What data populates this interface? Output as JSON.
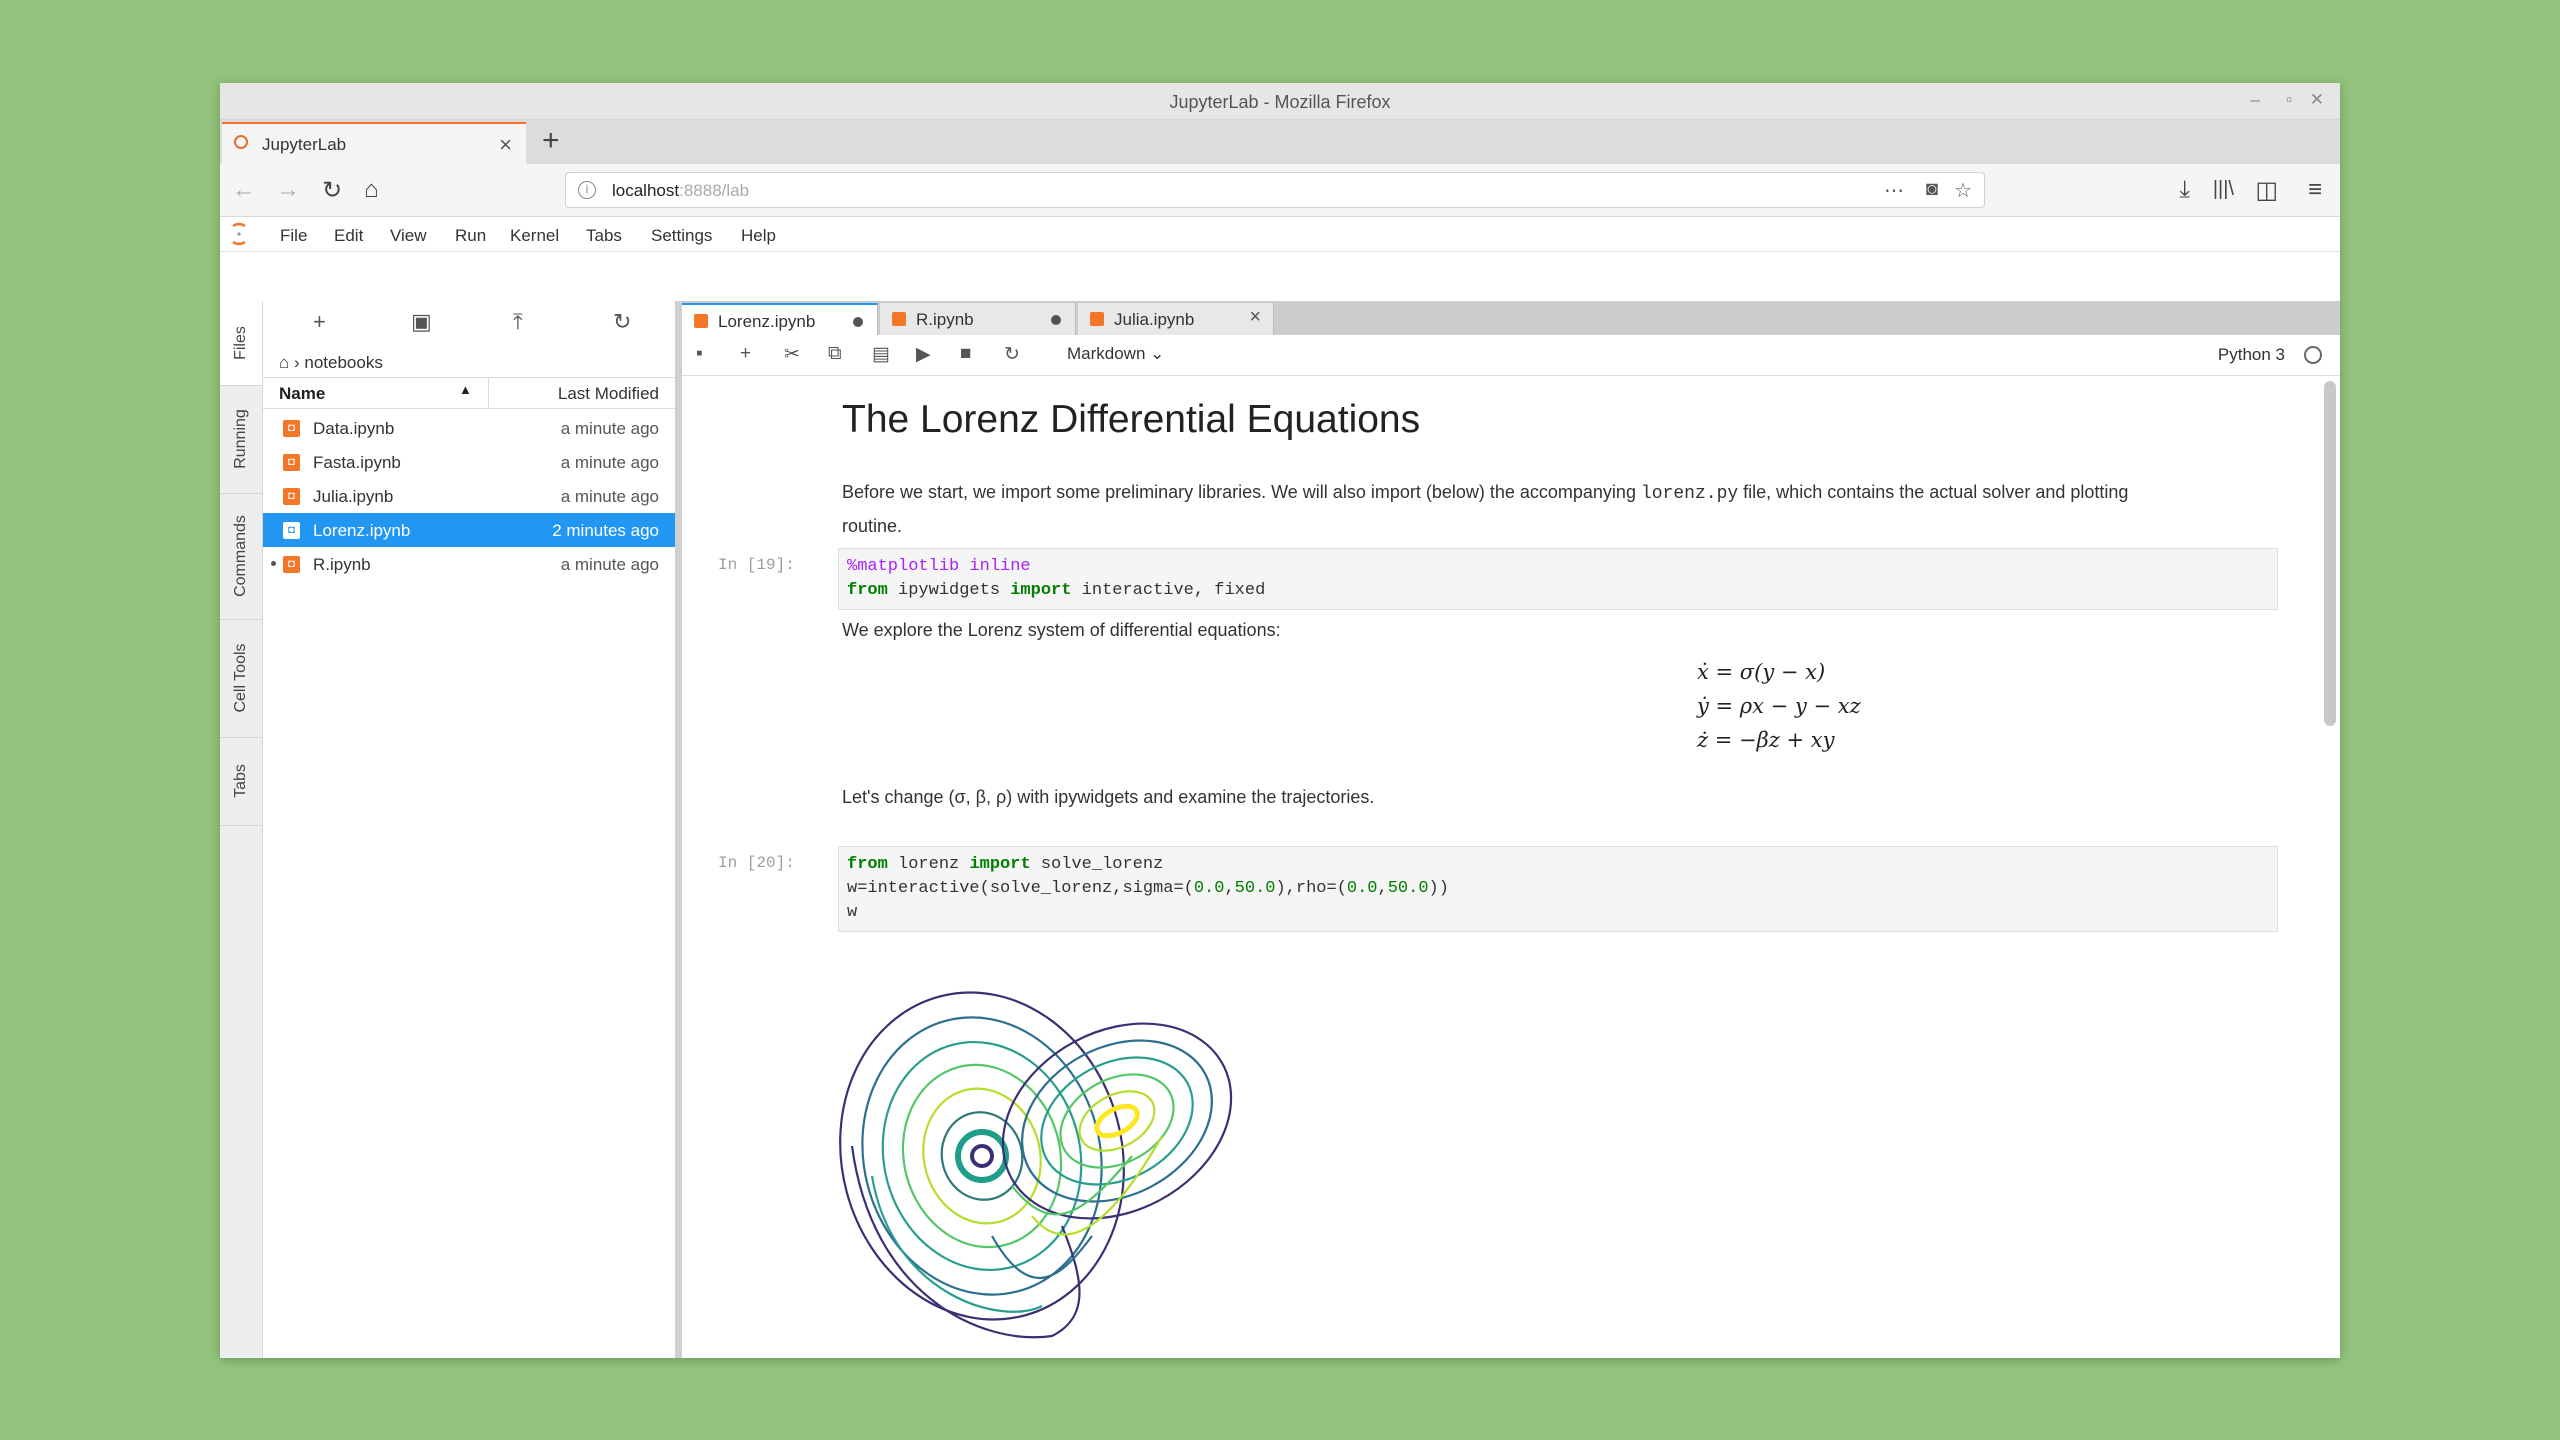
{
  "window": {
    "title": "JupyterLab - Mozilla Firefox"
  },
  "browser": {
    "tab_label": "JupyterLab",
    "url_host": "localhost",
    "url_rest": ":8888/lab"
  },
  "menu": [
    "File",
    "Edit",
    "View",
    "Run",
    "Kernel",
    "Tabs",
    "Settings",
    "Help"
  ],
  "sidebar_tabs": [
    "Files",
    "Running",
    "Commands",
    "Cell Tools",
    "Tabs"
  ],
  "filebrowser": {
    "breadcrumb": "notebooks",
    "col_name": "Name",
    "col_modified": "Last Modified",
    "files": [
      {
        "name": "Data.ipynb",
        "modified": "a minute ago"
      },
      {
        "name": "Fasta.ipynb",
        "modified": "a minute ago"
      },
      {
        "name": "Julia.ipynb",
        "modified": "a minute ago"
      },
      {
        "name": "Lorenz.ipynb",
        "modified": "2 minutes ago"
      },
      {
        "name": "R.ipynb",
        "modified": "a minute ago"
      }
    ]
  },
  "doc_tabs": [
    {
      "label": "Lorenz.ipynb"
    },
    {
      "label": "R.ipynb"
    },
    {
      "label": "Julia.ipynb"
    }
  ],
  "notebook_toolbar": {
    "cell_type": "Markdown",
    "kernel": "Python 3"
  },
  "notebook": {
    "heading": "The Lorenz Differential Equations",
    "intro_1": "Before we start, we import some preliminary libraries. We will also import (below) the accompanying ",
    "intro_code": "lorenz.py",
    "intro_2": " file, which contains the actual solver and plotting",
    "intro_3": "routine.",
    "cell1_prompt": "In [19]:",
    "cell1_line1_magic": "%matplotlib inline",
    "cell1_line2_kw1": "from",
    "cell1_line2_mod": " ipywidgets ",
    "cell1_line2_kw2": "import",
    "cell1_line2_rest": " interactive, fixed",
    "explore": "We explore the Lorenz system of differential equations:",
    "eq1": "ẋ = σ(y − x)",
    "eq2": "ẏ = ρx − y − xz",
    "eq3": "ż = −βz + xy",
    "change": "Let's change (σ, β, ρ) with ipywidgets and examine the trajectories.",
    "cell2_prompt": "In [20]:",
    "cell2_l1_kw1": "from",
    "cell2_l1_mod": " lorenz ",
    "cell2_l1_kw2": "import",
    "cell2_l1_rest": " solve_lorenz",
    "cell2_l2_a": "w=interactive(solve_lorenz,sigma=(",
    "cell2_l2_n1": "0.0",
    "cell2_l2_b": ",",
    "cell2_l2_n2": "50.0",
    "cell2_l2_c": "),rho=(",
    "cell2_l2_n3": "0.0",
    "cell2_l2_d": ",",
    "cell2_l2_n4": "50.0",
    "cell2_l2_e": "))",
    "cell2_l3": "w"
  },
  "colors": {
    "accent": "#2196f3",
    "notebook_icon": "#f37726",
    "background": "#93c47d"
  }
}
